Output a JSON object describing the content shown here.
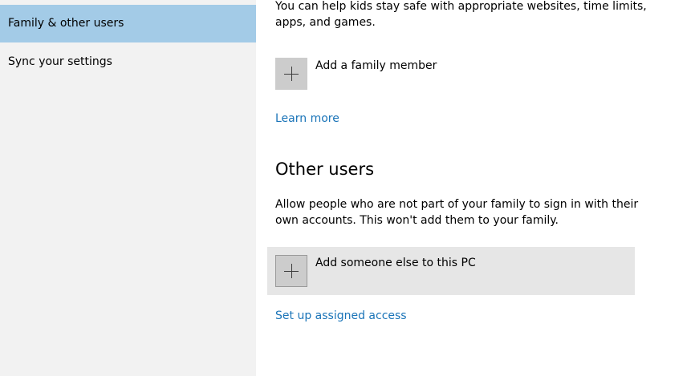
{
  "sidebar": {
    "items": [
      {
        "label": "Family & other users",
        "selected": true
      },
      {
        "label": "Sync your settings",
        "selected": false
      }
    ]
  },
  "family": {
    "description": "You can help kids stay safe with appropriate websites, time limits, apps, and games.",
    "add_label": "Add a family member",
    "add_icon": "plus-icon",
    "learn_more": "Learn more"
  },
  "other_users": {
    "title": "Other users",
    "description": "Allow people who are not part of your family to sign in with their own accounts. This won't add them to your family.",
    "add_label": "Add someone else to this PC",
    "add_icon": "plus-icon",
    "assigned_access": "Set up assigned access"
  },
  "colors": {
    "selected_nav": "#a3cbe7",
    "sidebar_bg": "#f2f2f2",
    "link": "#1a74b8",
    "tile": "#cccccc",
    "hover_row": "#e6e6e6"
  }
}
